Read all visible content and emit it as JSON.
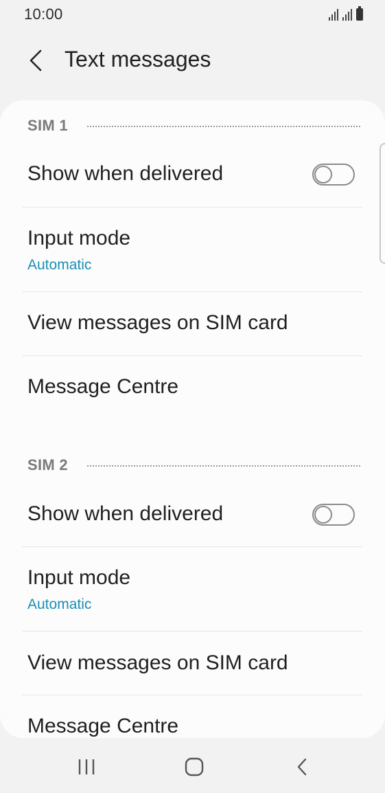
{
  "status_bar": {
    "time": "10:00",
    "icons": [
      "signal-icon",
      "signal-icon",
      "battery-icon"
    ]
  },
  "app_bar": {
    "title": "Text messages",
    "back_icon": "back-arrow-icon"
  },
  "sections": [
    {
      "header": "SIM 1",
      "items": [
        {
          "title": "Show when delivered",
          "toggle": false
        },
        {
          "title": "Input mode",
          "subtitle": "Automatic"
        },
        {
          "title": "View messages on SIM card"
        },
        {
          "title": "Message Centre"
        }
      ]
    },
    {
      "header": "SIM 2",
      "items": [
        {
          "title": "Show when delivered",
          "toggle": false
        },
        {
          "title": "Input mode",
          "subtitle": "Automatic"
        },
        {
          "title": "View messages on SIM card"
        },
        {
          "title": "Message Centre"
        }
      ]
    }
  ],
  "nav_bar": {
    "buttons": [
      "recent-apps-icon",
      "home-icon",
      "back-icon"
    ]
  },
  "colors": {
    "background": "#f2f2f2",
    "card": "#fcfcfc",
    "accent": "#1b8eb4",
    "section_header": "#7a7a7a"
  }
}
